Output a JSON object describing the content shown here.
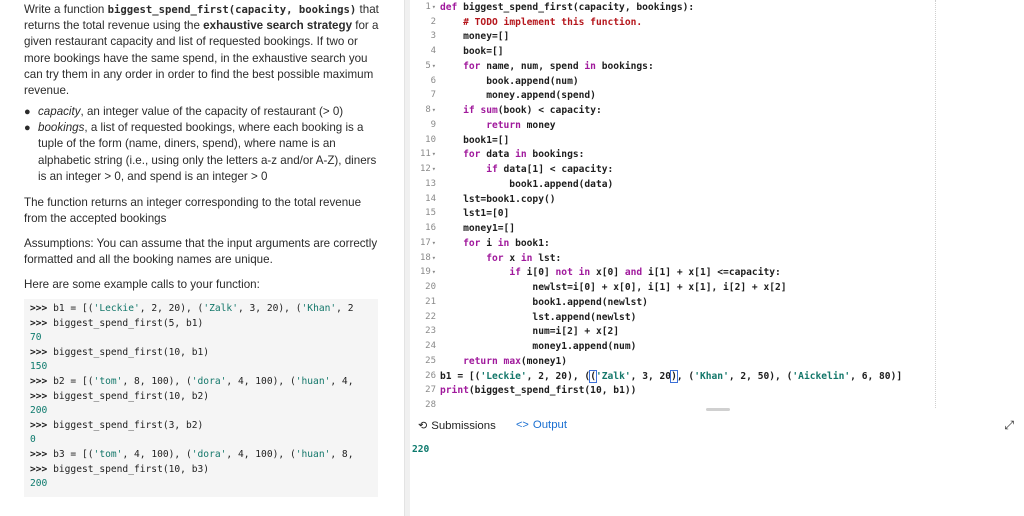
{
  "description": {
    "intro_1": "Write a function ",
    "func_sig": "biggest_spend_first(capacity, bookings)",
    "intro_2": " that returns the total revenue using the ",
    "intro_bold": "exhaustive search strategy",
    "intro_3": " for a given restaurant capacity and list of requested bookings. If two or more bookings have the same spend, in the exhaustive search you can try them in any order in order to find the best possible maximum revenue.",
    "bullets": [
      {
        "term": "capacity",
        "text": ", an integer value of the capacity of restaurant (> 0)"
      },
      {
        "term": "bookings",
        "text": ", a list of requested bookings, where each booking is a tuple of the form (name, diners, spend), where name is an alphabetic string (i.e., using only the letters a-z and/or A-Z), diners is an integer > 0, and spend is an integer > 0"
      }
    ],
    "returns": "The function returns an integer corresponding to the total revenue from the accepted bookings",
    "assumptions": "Assumptions: You can assume that the input arguments are correctly formatted and all the booking names are unique.",
    "example_intro": "Here are some example calls to your function:"
  },
  "examples": [
    {
      "type": "in",
      "text": "b1 = [('Leckie', 2, 20), ('Zalk', 3, 20), ('Khan', 2"
    },
    {
      "type": "in",
      "text": "biggest_spend_first(5, b1)"
    },
    {
      "type": "out",
      "text": "70"
    },
    {
      "type": "in",
      "text": "biggest_spend_first(10, b1)"
    },
    {
      "type": "out",
      "text": "150"
    },
    {
      "type": "in",
      "text": "b2 = [('tom', 8, 100), ('dora', 4, 100), ('huan', 4,"
    },
    {
      "type": "in",
      "text": "biggest_spend_first(10, b2)"
    },
    {
      "type": "out",
      "text": "200"
    },
    {
      "type": "in",
      "text": "biggest_spend_first(3, b2)"
    },
    {
      "type": "out",
      "text": "0"
    },
    {
      "type": "in",
      "text": "b3 = [('tom', 4, 100), ('dora', 4, 100), ('huan', 8,"
    },
    {
      "type": "in",
      "text": "biggest_spend_first(10, b3)"
    },
    {
      "type": "out",
      "text": "200"
    }
  ],
  "prompt_symbol": ">>> ",
  "code_lines": [
    "def biggest_spend_first(capacity, bookings):",
    "    # TODO implement this function.",
    "    money=[]",
    "    book=[]",
    "    for name, num, spend in bookings:",
    "        book.append(num)",
    "        money.append(spend)",
    "    if sum(book) < capacity:",
    "        return money",
    "    book1=[]",
    "    for data in bookings:",
    "        if data[1] < capacity:",
    "            book1.append(data)",
    "    lst=book1.copy()",
    "    lst1=[0]",
    "    money1=[]",
    "    for i in book1:",
    "        for x in lst:",
    "            if i[0] not in x[0] and i[1] + x[1] <=capacity:",
    "                newlst=i[0] + x[0], i[1] + x[1], i[2] + x[2]",
    "                book1.append(newlst)",
    "                lst.append(newlst)",
    "                num=i[2] + x[2]",
    "                money1.append(num)",
    "    return max(money1)",
    "b1 = [('Leckie', 2, 20), ('Zalk', 3, 20), ('Khan', 2, 50), ('Aickelin', 6, 80)]",
    "print(biggest_spend_first(10, b1))",
    ""
  ],
  "line_numbers": [
    "1",
    "2",
    "3",
    "4",
    "5",
    "6",
    "7",
    "8",
    "9",
    "10",
    "11",
    "12",
    "13",
    "14",
    "15",
    "16",
    "17",
    "18",
    "19",
    "20",
    "21",
    "22",
    "23",
    "24",
    "25",
    "26",
    "27",
    "28"
  ],
  "fold_lines": [
    1,
    5,
    8,
    11,
    12,
    17,
    18,
    19
  ],
  "tabs": {
    "submissions": "Submissions",
    "output": "Output"
  },
  "output_value": "220",
  "icons": {
    "submissions": "history-icon",
    "output": "code-icon",
    "expand": "expand-icon"
  }
}
